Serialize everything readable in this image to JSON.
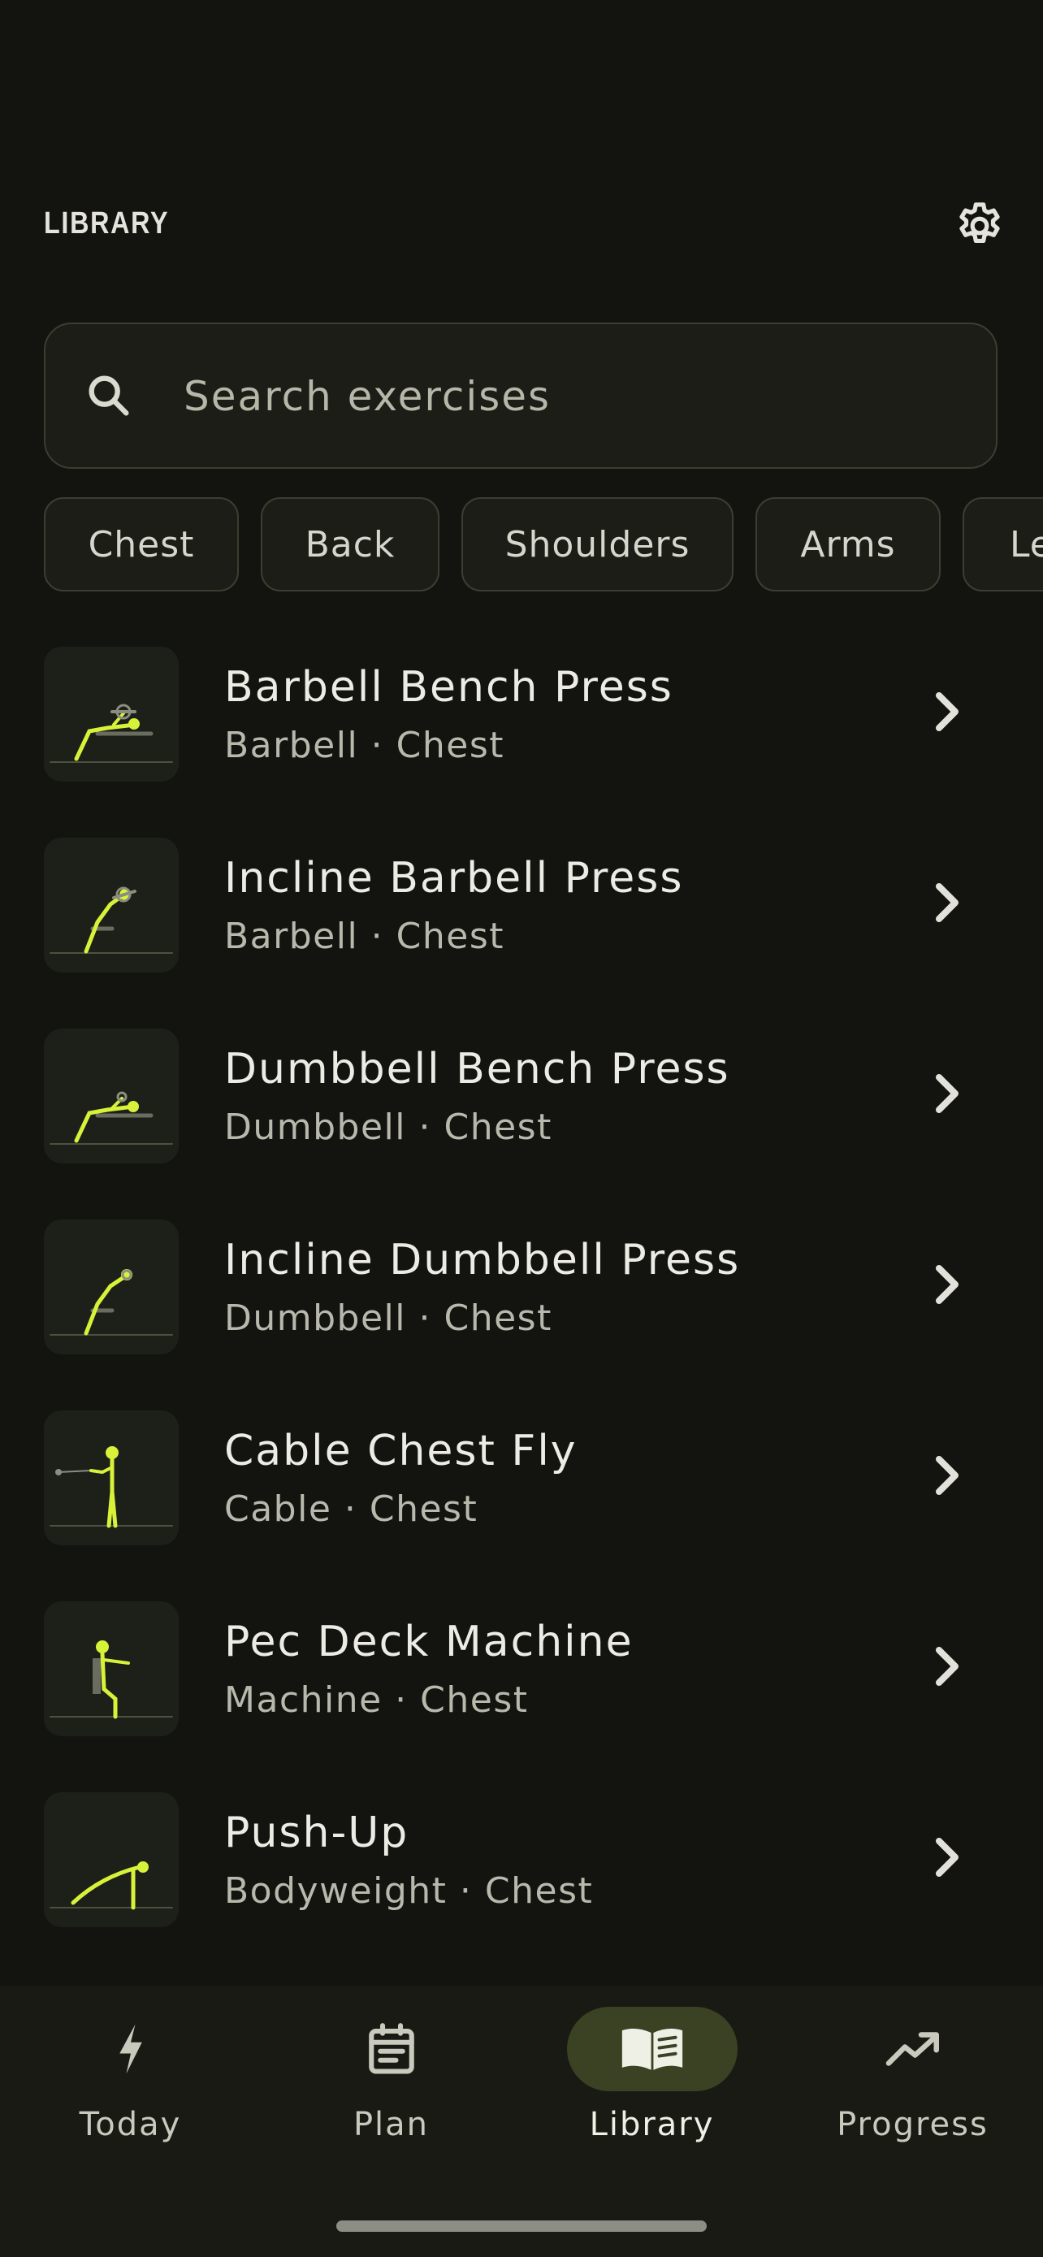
{
  "header": {
    "title": "LIBRARY",
    "settings_icon": "gear-icon"
  },
  "search": {
    "placeholder": "Search exercises",
    "value": "",
    "icon": "search-icon"
  },
  "filters": {
    "chips": [
      "Chest",
      "Back",
      "Shoulders",
      "Arms",
      "Le"
    ]
  },
  "exercises": [
    {
      "name": "Barbell Bench Press",
      "meta": "Barbell · Chest"
    },
    {
      "name": "Incline Barbell Press",
      "meta": "Barbell · Chest"
    },
    {
      "name": "Dumbbell Bench Press",
      "meta": "Dumbbell · Chest"
    },
    {
      "name": "Incline Dumbbell Press",
      "meta": "Dumbbell · Chest"
    },
    {
      "name": "Cable Chest Fly",
      "meta": "Cable · Chest"
    },
    {
      "name": "Pec Deck Machine",
      "meta": "Machine · Chest"
    },
    {
      "name": "Push-Up",
      "meta": "Bodyweight · Chest"
    }
  ],
  "nav": {
    "items": [
      {
        "label": "Today",
        "icon": "lightning-bolt-icon",
        "active": false
      },
      {
        "label": "Plan",
        "icon": "calendar-icon",
        "active": false
      },
      {
        "label": "Library",
        "icon": "book-icon",
        "active": true
      },
      {
        "label": "Progress",
        "icon": "trending-up-icon",
        "active": false
      }
    ]
  },
  "colors": {
    "background": "#131410",
    "accent": "#d8f23a",
    "active_pill": "#3a4223",
    "text_primary": "#ecece5",
    "text_secondary": "#b8b9ac"
  }
}
